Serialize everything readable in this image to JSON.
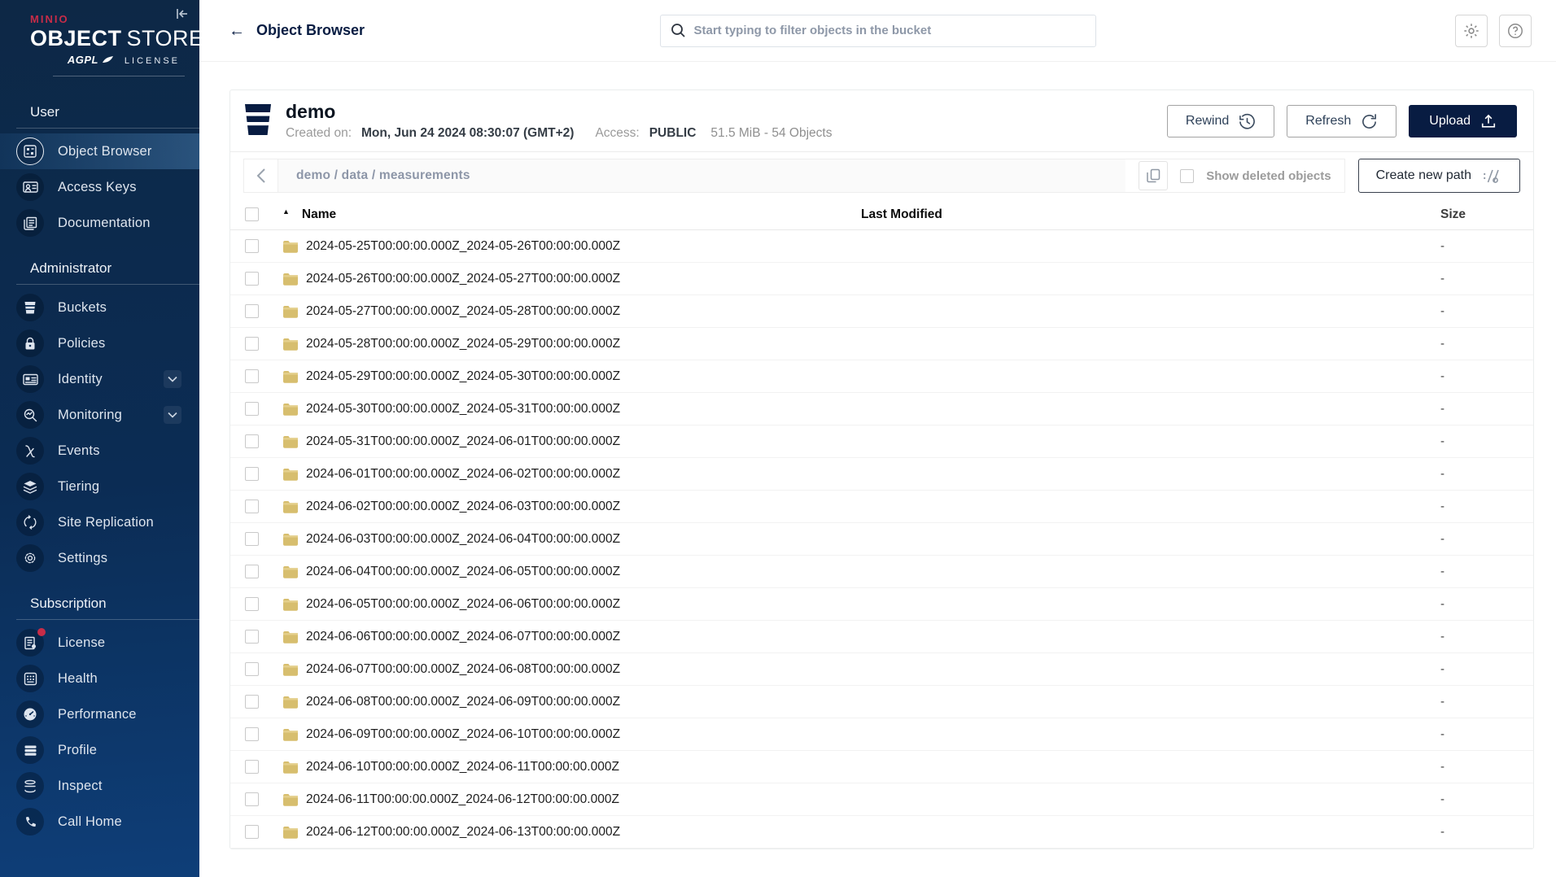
{
  "colors": {
    "brand_red": "#C72C48",
    "navy": "#081C42",
    "folder": "#D7BE6E",
    "active_item_highlight": "#4a7fb0"
  },
  "sidebar": {
    "logo": {
      "brand": "MINIO",
      "product_bold": "OBJECT",
      "product_light": "STORE",
      "license_badge": "AGPL",
      "license_word": "LICENSE"
    },
    "sections": [
      {
        "title": "User",
        "items": [
          {
            "label": "Object Browser",
            "icon": "object-browser-icon",
            "active": true
          },
          {
            "label": "Access Keys",
            "icon": "access-keys-icon"
          },
          {
            "label": "Documentation",
            "icon": "documentation-icon"
          }
        ]
      },
      {
        "title": "Administrator",
        "items": [
          {
            "label": "Buckets",
            "icon": "buckets-icon"
          },
          {
            "label": "Policies",
            "icon": "policies-icon"
          },
          {
            "label": "Identity",
            "icon": "identity-icon",
            "expandable": true
          },
          {
            "label": "Monitoring",
            "icon": "monitoring-icon",
            "expandable": true
          },
          {
            "label": "Events",
            "icon": "events-icon"
          },
          {
            "label": "Tiering",
            "icon": "tiering-icon"
          },
          {
            "label": "Site Replication",
            "icon": "site-replication-icon"
          },
          {
            "label": "Settings",
            "icon": "settings-icon"
          }
        ]
      },
      {
        "title": "Subscription",
        "items": [
          {
            "label": "License",
            "icon": "license-icon",
            "badge": true
          },
          {
            "label": "Health",
            "icon": "health-icon"
          },
          {
            "label": "Performance",
            "icon": "performance-icon"
          },
          {
            "label": "Profile",
            "icon": "profile-icon"
          },
          {
            "label": "Inspect",
            "icon": "inspect-icon"
          },
          {
            "label": "Call Home",
            "icon": "call-home-icon"
          }
        ]
      }
    ]
  },
  "topbar": {
    "back_icon": "←",
    "title": "Object Browser",
    "search_placeholder": "Start typing to filter objects in the bucket"
  },
  "bucket": {
    "name": "demo",
    "created_label": "Created on:",
    "created_value": "Mon, Jun 24 2024 08:30:07 (GMT+2)",
    "access_label": "Access:",
    "access_value": "PUBLIC",
    "usage": "51.5 MiB - 54 Objects",
    "actions": {
      "rewind": "Rewind",
      "refresh": "Refresh",
      "upload": "Upload"
    }
  },
  "toolbar": {
    "breadcrumb": "demo / data / measurements",
    "show_deleted_label": "Show deleted objects",
    "create_path_label": "Create new path"
  },
  "table": {
    "sort_icon": "▲",
    "columns": {
      "name": "Name",
      "last_modified": "Last Modified",
      "size": "Size"
    },
    "rows": [
      {
        "name": "2024-05-25T00:00:00.000Z_2024-05-26T00:00:00.000Z",
        "last_modified": "",
        "size": "-"
      },
      {
        "name": "2024-05-26T00:00:00.000Z_2024-05-27T00:00:00.000Z",
        "last_modified": "",
        "size": "-"
      },
      {
        "name": "2024-05-27T00:00:00.000Z_2024-05-28T00:00:00.000Z",
        "last_modified": "",
        "size": "-"
      },
      {
        "name": "2024-05-28T00:00:00.000Z_2024-05-29T00:00:00.000Z",
        "last_modified": "",
        "size": "-"
      },
      {
        "name": "2024-05-29T00:00:00.000Z_2024-05-30T00:00:00.000Z",
        "last_modified": "",
        "size": "-"
      },
      {
        "name": "2024-05-30T00:00:00.000Z_2024-05-31T00:00:00.000Z",
        "last_modified": "",
        "size": "-"
      },
      {
        "name": "2024-05-31T00:00:00.000Z_2024-06-01T00:00:00.000Z",
        "last_modified": "",
        "size": "-"
      },
      {
        "name": "2024-06-01T00:00:00.000Z_2024-06-02T00:00:00.000Z",
        "last_modified": "",
        "size": "-"
      },
      {
        "name": "2024-06-02T00:00:00.000Z_2024-06-03T00:00:00.000Z",
        "last_modified": "",
        "size": "-"
      },
      {
        "name": "2024-06-03T00:00:00.000Z_2024-06-04T00:00:00.000Z",
        "last_modified": "",
        "size": "-"
      },
      {
        "name": "2024-06-04T00:00:00.000Z_2024-06-05T00:00:00.000Z",
        "last_modified": "",
        "size": "-"
      },
      {
        "name": "2024-06-05T00:00:00.000Z_2024-06-06T00:00:00.000Z",
        "last_modified": "",
        "size": "-"
      },
      {
        "name": "2024-06-06T00:00:00.000Z_2024-06-07T00:00:00.000Z",
        "last_modified": "",
        "size": "-"
      },
      {
        "name": "2024-06-07T00:00:00.000Z_2024-06-08T00:00:00.000Z",
        "last_modified": "",
        "size": "-"
      },
      {
        "name": "2024-06-08T00:00:00.000Z_2024-06-09T00:00:00.000Z",
        "last_modified": "",
        "size": "-"
      },
      {
        "name": "2024-06-09T00:00:00.000Z_2024-06-10T00:00:00.000Z",
        "last_modified": "",
        "size": "-"
      },
      {
        "name": "2024-06-10T00:00:00.000Z_2024-06-11T00:00:00.000Z",
        "last_modified": "",
        "size": "-"
      },
      {
        "name": "2024-06-11T00:00:00.000Z_2024-06-12T00:00:00.000Z",
        "last_modified": "",
        "size": "-"
      },
      {
        "name": "2024-06-12T00:00:00.000Z_2024-06-13T00:00:00.000Z",
        "last_modified": "",
        "size": "-"
      }
    ]
  }
}
